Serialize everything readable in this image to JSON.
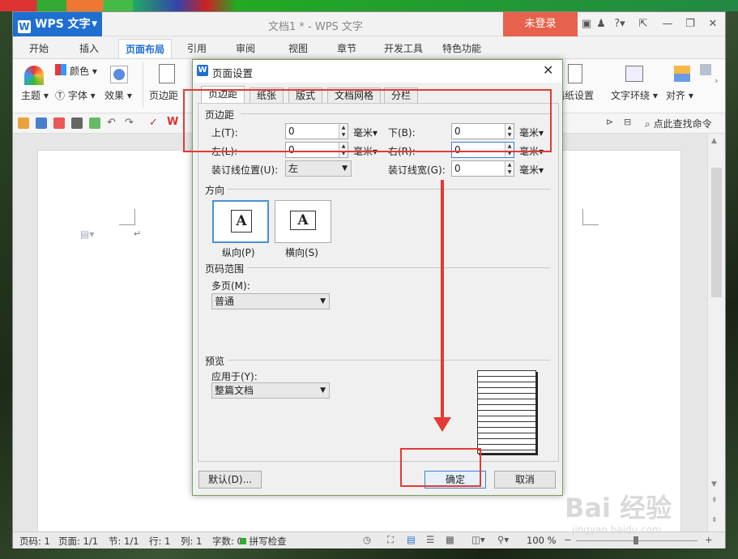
{
  "app": {
    "name": "WPS 文字",
    "doc_title": "文档1 * - WPS 文字",
    "login": "未登录"
  },
  "ribbon_tabs": [
    "开始",
    "插入",
    "页面布局",
    "引用",
    "审阅",
    "视图",
    "章节",
    "开发工具",
    "特色功能"
  ],
  "ribbon": {
    "theme": "主题",
    "colors": "颜色",
    "font": "字体",
    "effects": "效果",
    "margins": "页边距",
    "paper_setup": "稿纸设置",
    "text_wrap": "文字环绕",
    "align": "对齐",
    "search": "点此查找命令"
  },
  "dialog": {
    "title": "页面设置",
    "tabs": [
      "页边距",
      "纸张",
      "版式",
      "文档网格",
      "分栏"
    ],
    "margins_section": "页边距",
    "top_label": "上(T):",
    "top_value": "0",
    "bottom_label": "下(B):",
    "bottom_value": "0",
    "left_label": "左(L):",
    "left_value": "0",
    "right_label": "右(R):",
    "right_value": "0",
    "unit": "毫米",
    "gutter_pos_label": "装订线位置(U):",
    "gutter_pos_value": "左",
    "gutter_width_label": "装订线宽(G):",
    "gutter_width_value": "0",
    "orientation_section": "方向",
    "portrait": "纵向(P)",
    "landscape": "横向(S)",
    "page_range_section": "页码范围",
    "multi_pages_label": "多页(M):",
    "multi_pages_value": "普通",
    "preview_section": "预览",
    "apply_to_label": "应用于(Y):",
    "apply_to_value": "整篇文档",
    "default_btn": "默认(D)...",
    "ok_btn": "确定",
    "cancel_btn": "取消"
  },
  "status": {
    "page": "页码: 1",
    "pages": "页面: 1/1",
    "section": "节: 1/1",
    "row": "行: 1",
    "col": "列: 1",
    "words": "字数: 0",
    "spell": "拼写检查",
    "zoom": "100 %"
  },
  "watermark": {
    "text": "Bai 经验",
    "url": "jingyan.baidu.com"
  }
}
